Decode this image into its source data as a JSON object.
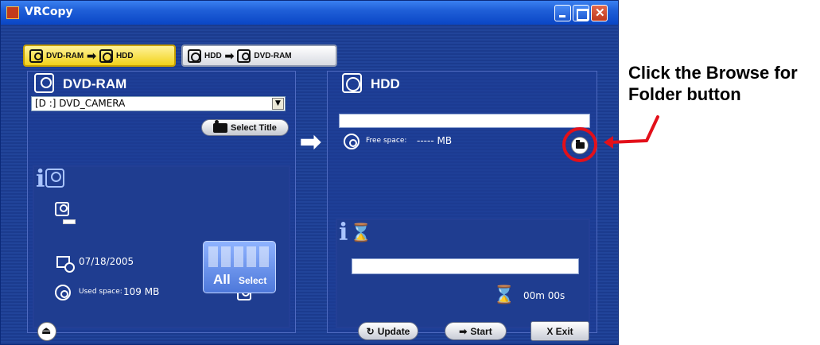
{
  "window": {
    "title": "VRCopy"
  },
  "tabs": [
    {
      "from": "DVD-RAM",
      "to": "HDD",
      "active": true
    },
    {
      "from": "HDD",
      "to": "DVD-RAM",
      "active": false
    }
  ],
  "source_panel": {
    "title": "DVD-RAM",
    "drive_select_value": "[D :] DVD_CAMERA",
    "select_title_label": "Select Title",
    "date": "07/18/2005",
    "used_space_label": "Used space:",
    "used_space_value": "109 MB",
    "all_label": "All",
    "select_label": "Select"
  },
  "dest_panel": {
    "title": "HDD",
    "path_value": "",
    "free_space_label": "Free space:",
    "free_space_value": "----- MB",
    "elapsed_time": "00m 00s"
  },
  "bottom_bar": {
    "update_label": "Update",
    "start_label": "Start",
    "exit_label": "X  Exit"
  },
  "annotation": {
    "text": "Click the Browse for Folder button",
    "color": "#e3101a"
  },
  "icons": [
    "eject-icon",
    "folder-icon",
    "camera-icon",
    "hourglass-icon",
    "calendar-icon",
    "disc-icon",
    "hdd-icon"
  ]
}
